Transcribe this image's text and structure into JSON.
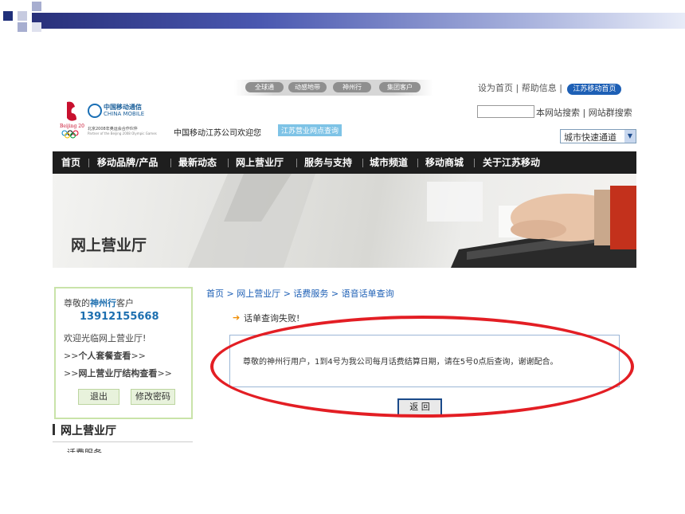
{
  "top_tabs": [
    "全球通",
    "动感地带",
    "神州行",
    "集团客户"
  ],
  "top_links": {
    "set_home": "设为首页",
    "help": "帮助信息",
    "jiangsu_home": "江苏移动首页"
  },
  "brand": {
    "cn": "中国移动通信",
    "en": "CHINA MOBILE",
    "partner": "北京2008年奥运会合作伙伴",
    "partner_en": "Partner of the Beijing 2008 Olympic Games"
  },
  "welcome": "中国移动江苏公司欢迎您",
  "outlet_query": "江苏营业网点查询",
  "search": {
    "value": "",
    "site_search": "本网站搜索",
    "group_search": "网站群搜索"
  },
  "city_select": "城市快速通道",
  "nav": [
    "首页",
    "移动品牌/产品",
    "最新动态",
    "网上营业厅",
    "服务与支持",
    "城市频道",
    "移动商城",
    "关于江苏移动"
  ],
  "banner_title": "网上营业厅",
  "sidebar": {
    "greeting_prefix": "尊敬的",
    "brand": "神州行",
    "greeting_suffix": "客户",
    "phone": "13912155668",
    "welcome": "欢迎光临网上营业厅!",
    "link1_prefix": ">>",
    "link1": "个人套餐查看",
    "link1_suffix": ">>",
    "link2_prefix": ">>",
    "link2": "网上营业厅结构查看",
    "link2_suffix": ">>",
    "logout": "退出",
    "change_password": "修改密码",
    "section_title": "网上营业厅",
    "cut_item": "话费服务"
  },
  "breadcrumb": "首页 > 网上营业厅 > 话费服务 > 语音话单查询",
  "fail_text": "话单查询失败!",
  "message": "尊敬的神州行用户，1到4号为我公司每月话费结算日期，请在5号0点后查询，谢谢配合。",
  "return_button": "返 回",
  "colors": {
    "nav_bg": "#1e1e1e",
    "link_blue": "#1d5fb5",
    "highlight_red": "#e31e24",
    "side_border": "#c9e3a9"
  }
}
